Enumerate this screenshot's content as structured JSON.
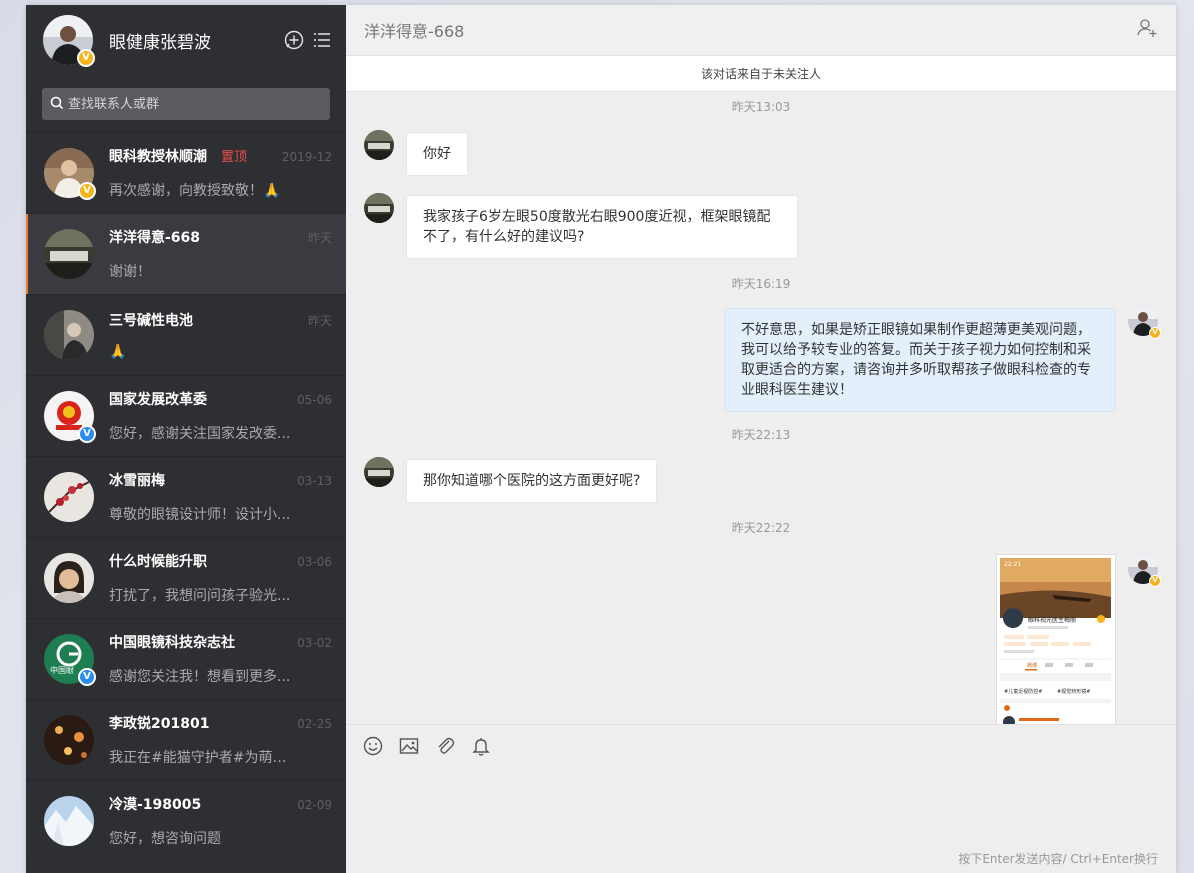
{
  "user": {
    "name": "眼健康张碧波"
  },
  "search": {
    "placeholder": "查找联系人或群"
  },
  "conversations": [
    {
      "name": "眼科教授林顺潮",
      "pin": "置顶",
      "time": "2019-12",
      "msg": "再次感谢，向教授致敬！🙏",
      "badge": "V",
      "badge_color": "gold"
    },
    {
      "name": "洋洋得意-668",
      "pin": "",
      "time": "昨天",
      "msg": "谢谢！",
      "badge": "",
      "active": true
    },
    {
      "name": "三号碱性电池",
      "pin": "",
      "time": "昨天",
      "msg": "🙏",
      "badge": ""
    },
    {
      "name": "国家发展改革委",
      "pin": "",
      "time": "05-06",
      "msg": "您好，感谢关注国家发改委...",
      "badge": "V",
      "badge_color": "blue"
    },
    {
      "name": "冰雪丽梅",
      "pin": "",
      "time": "03-13",
      "msg": "尊敬的眼镜设计师！设计小...",
      "badge": ""
    },
    {
      "name": "什么时候能升职",
      "pin": "",
      "time": "03-06",
      "msg": "打扰了，我想问问孩子验光...",
      "badge": ""
    },
    {
      "name": "中国眼镜科技杂志社",
      "pin": "",
      "time": "03-02",
      "msg": "感谢您关注我！想看到更多...",
      "badge": "V",
      "badge_color": "blue"
    },
    {
      "name": "李政锐201801",
      "pin": "",
      "time": "02-25",
      "msg": "我正在#能猫守护者#为萌萌...",
      "badge": ""
    },
    {
      "name": "冷漠-198005",
      "pin": "",
      "time": "02-09",
      "msg": "您好，想咨询问题",
      "badge": ""
    }
  ],
  "chat": {
    "title": "洋洋得意-668",
    "notice": "该对话来自于未关注人",
    "times": [
      "昨天13:03",
      "昨天16:19",
      "昨天22:13",
      "昨天22:22"
    ],
    "messages": [
      {
        "text": "你好"
      },
      {
        "text": "我家孩子6岁左眼50度散光右眼900度近视，框架眼镜配不了，有什么好的建议吗?"
      },
      {
        "text": "不好意思，如果是矫正眼镜如果制作更超薄更美观问题，我可以给予较专业的答复。而关于孩子视力如何控制和采取更适合的方案，请咨询并多听取帮孩子做眼科检查的专业眼科医生建议！"
      },
      {
        "text": "那你知道哪个医院的这方面更好呢?"
      }
    ],
    "image_card": {
      "time": "22:21",
      "name": "眼科视光医生梅丽",
      "tab": "微博",
      "tag1": "#儿童近视防控#",
      "tag2": "#视觉矫形镜#"
    },
    "hint": "按下Enter发送内容/ Ctrl+Enter换行"
  },
  "colors": {
    "sidebar": "#2e2f33",
    "accent": "#f07b2a",
    "pin": "#f04e4e",
    "bubble_self": "#e3f0fb"
  }
}
